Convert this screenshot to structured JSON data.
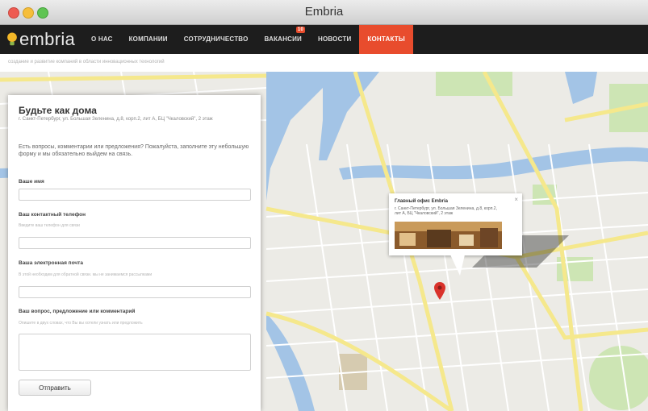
{
  "window": {
    "title": "Embria"
  },
  "header": {
    "logo_text": "embria",
    "nav": [
      {
        "label": "О НАС",
        "active": false,
        "badge": ""
      },
      {
        "label": "КОМПАНИИ",
        "active": false,
        "badge": ""
      },
      {
        "label": "СОТРУДНИЧЕСТВО",
        "active": false,
        "badge": ""
      },
      {
        "label": "ВАКАНСИИ",
        "active": false,
        "badge": "10"
      },
      {
        "label": "НОВОСТИ",
        "active": false,
        "badge": ""
      },
      {
        "label": "КОНТАКТЫ",
        "active": true,
        "badge": ""
      }
    ],
    "tagline": "создание и развитие компаний в области инновационных технологий"
  },
  "form": {
    "title": "Будьте как дома",
    "address": "г. Санкт-Петербург, ул. Большая Зеленина, д.8, корп.2, лит А, БЦ \"Чкаловский\", 2 этаж",
    "intro": "Есть вопросы, комментарии или предложения? Пожалуйста, заполните эту небольшую форму и мы обязательно выйдем на связь.",
    "fields": [
      {
        "label": "Ваше имя",
        "hint": "",
        "value": ""
      },
      {
        "label": "Ваш контактный телефон",
        "hint": "Введите ваш телефон для связи",
        "value": ""
      },
      {
        "label": "Ваша электронная почта",
        "hint": "В этой необходим для обратной связи. мы не занимаемся рассылками",
        "value": ""
      },
      {
        "label": "Ваш вопрос, предложение или комментарий",
        "hint": "Опишите в двух словах, что Вы вы хотели узнать или предложить",
        "value": ""
      }
    ],
    "submit_label": "Отправить"
  },
  "map": {
    "info_title": "Главный офис Embria",
    "info_address": "г. Санкт-Петербург, ул. Большая Зеленина, д.8, корп.2, лит А, БЦ \"Чкаловский\", 2 этаж",
    "close_glyph": "×"
  },
  "colors": {
    "accent": "#e84c2d",
    "header_bg": "#1d1d1d",
    "water": "#a3c4e6",
    "park": "#cde5b4",
    "road_major": "#f5e88c"
  }
}
